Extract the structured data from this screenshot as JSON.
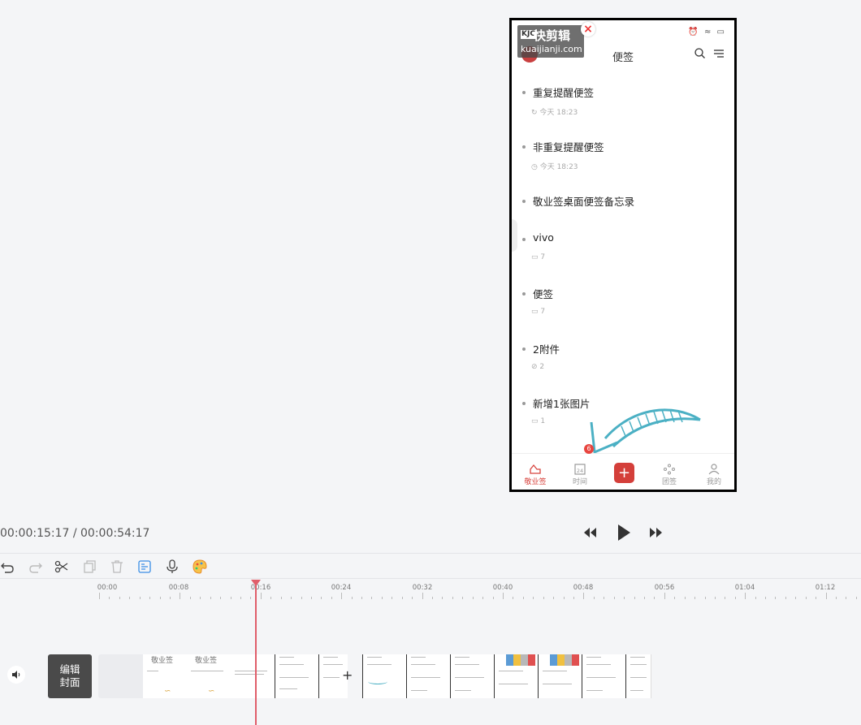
{
  "preview": {
    "watermark": {
      "logo": "KJC",
      "name": "快剪辑",
      "url": "kuaijianji.com"
    },
    "app_title": "便签",
    "notes": [
      {
        "title": "重复提醒便签",
        "meta": "今天 18:23",
        "meta_icon": "repeat-clock-icon"
      },
      {
        "title": "非重复提醒便签",
        "meta": "今天 18:23",
        "meta_icon": "clock-icon"
      },
      {
        "title": "敬业签桌面便签备忘录",
        "meta": "",
        "meta_icon": ""
      },
      {
        "title": "vivo",
        "meta": "7",
        "meta_icon": "image-icon"
      },
      {
        "title": "便签",
        "meta": "7",
        "meta_icon": "image-icon"
      },
      {
        "title": "2附件",
        "meta": "2",
        "meta_icon": "attachment-icon"
      },
      {
        "title": "新增1张图片",
        "meta": "1",
        "meta_icon": "image-icon"
      }
    ],
    "tabs": [
      {
        "label": "敬业签",
        "icon": "cloud-icon",
        "active": true
      },
      {
        "label": "时间",
        "icon": "calendar-icon",
        "badge": "6",
        "day": "24"
      },
      {
        "label": "团签",
        "icon": "team-icon"
      },
      {
        "label": "我的",
        "icon": "profile-icon"
      }
    ],
    "add_label": "+"
  },
  "player": {
    "timecode": "00:00:15:17 / 00:00:54:17"
  },
  "timeline": {
    "ruler_labels": [
      "00:00",
      "00:08",
      "00:16",
      "00:24",
      "00:32",
      "00:40",
      "00:48",
      "00:56",
      "01:04",
      "01:12"
    ],
    "cover_label_line1": "编辑",
    "cover_label_line2": "封面",
    "playhead_time": "00:15:17"
  },
  "colors": {
    "accent": "#d8453f",
    "playhead": "#e05e6a",
    "background": "#f4f5f7"
  }
}
